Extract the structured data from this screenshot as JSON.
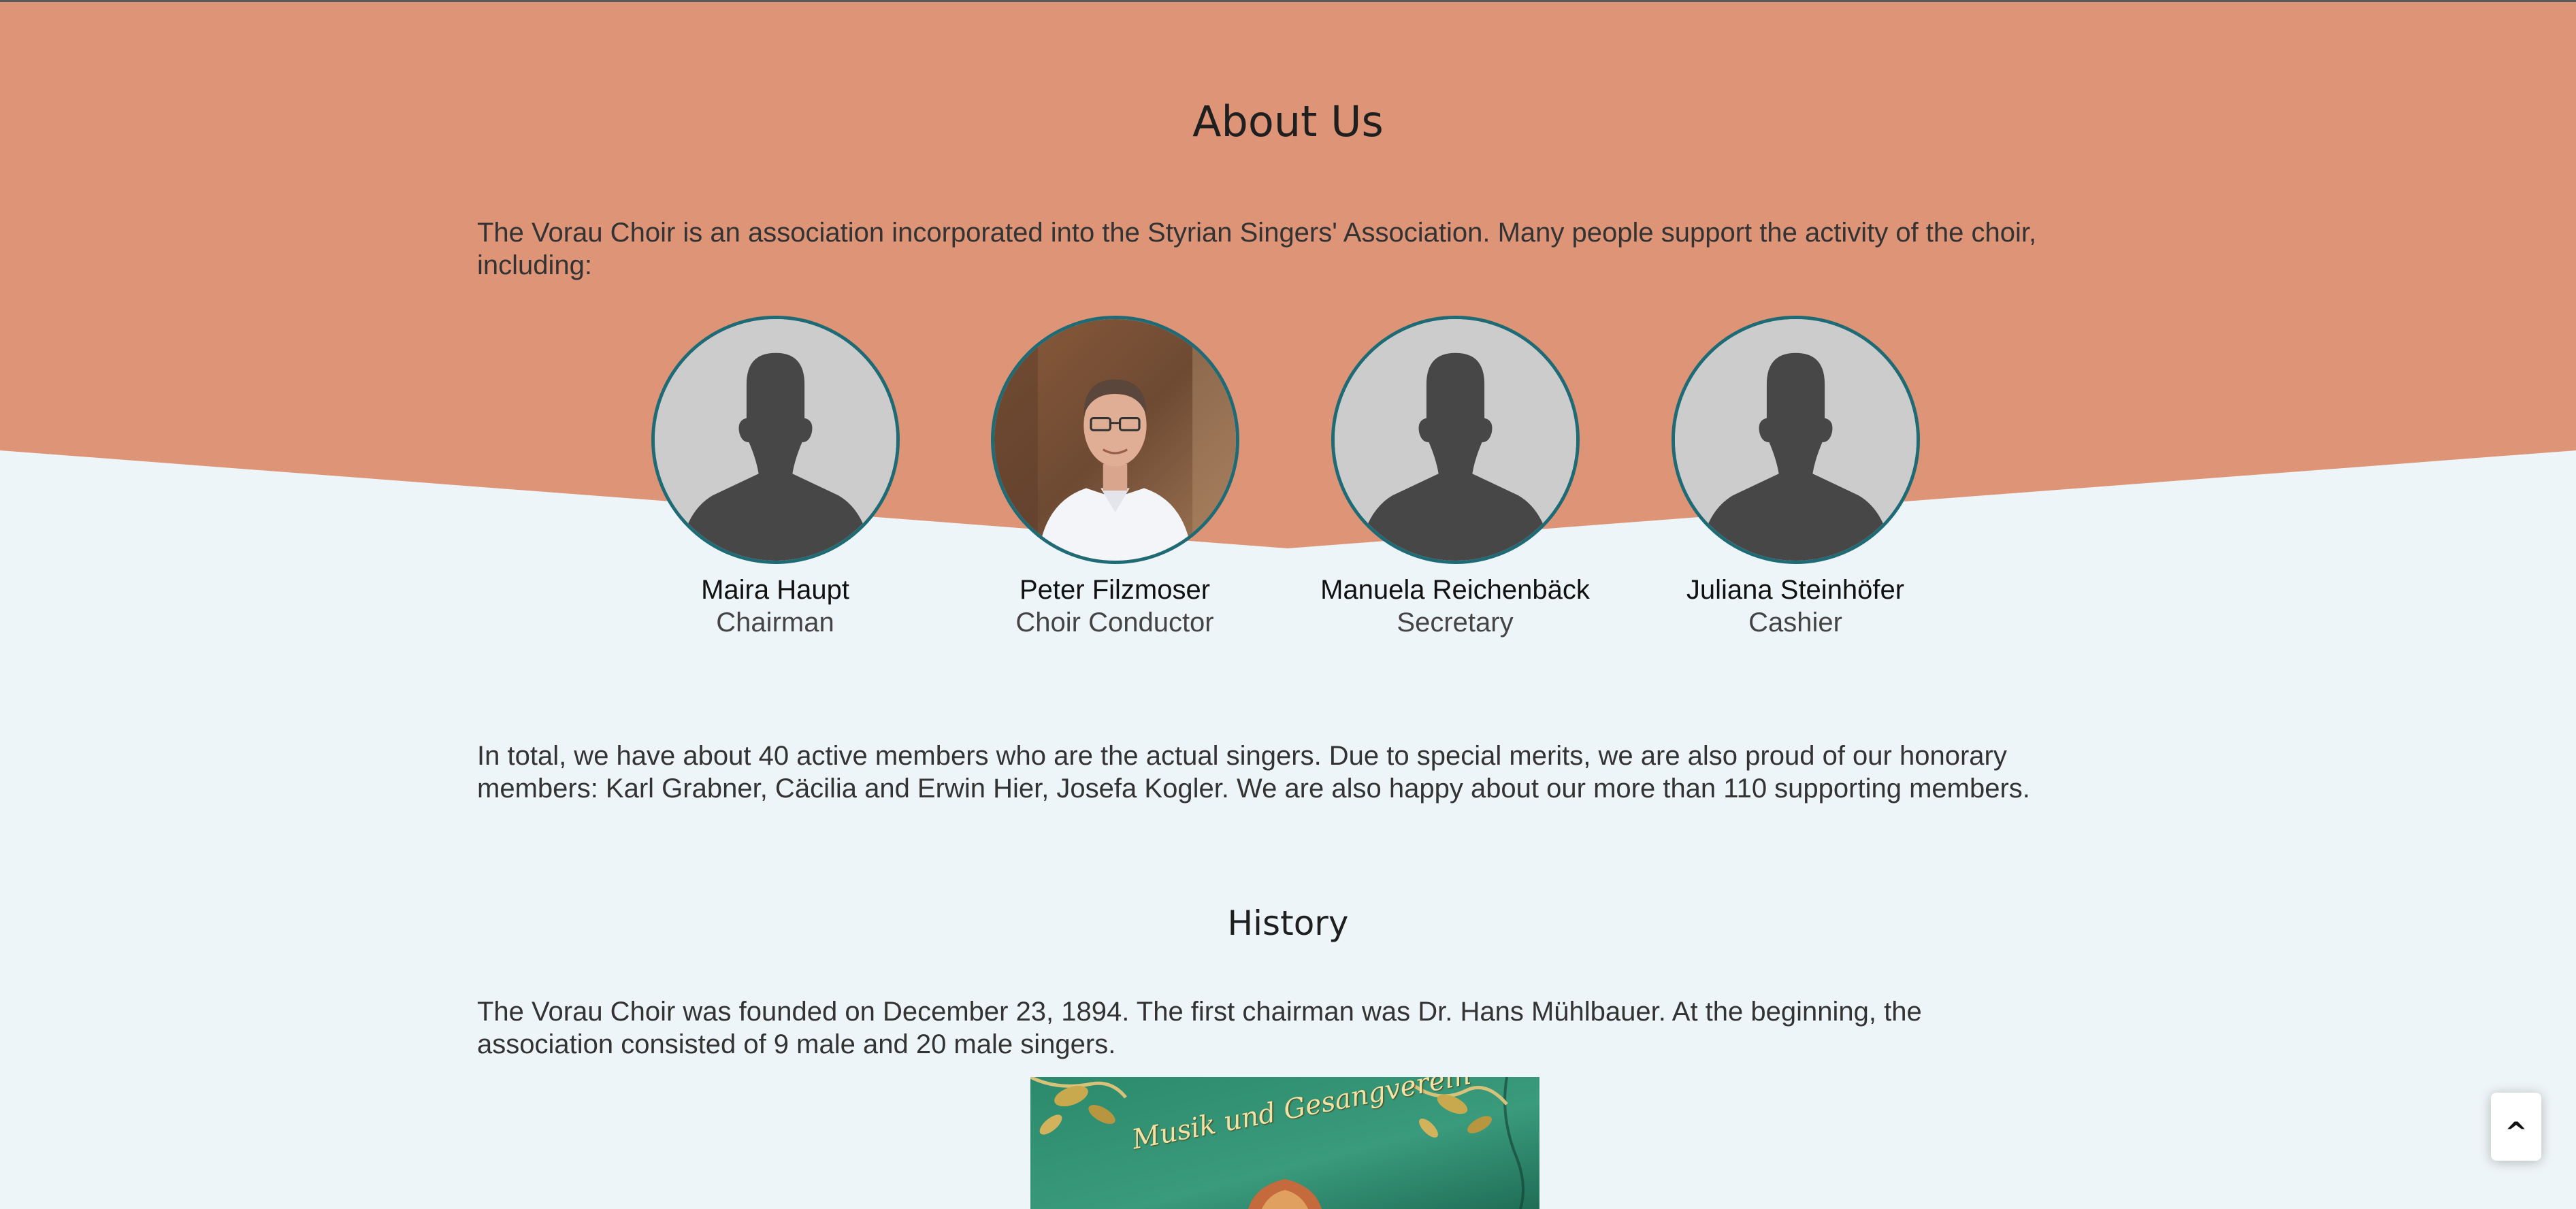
{
  "about": {
    "title": "About Us",
    "intro": "The Vorau Choir is an association incorporated into the Styrian Singers' Association. Many people support the activity of the choir, including:"
  },
  "people": [
    {
      "name": "Maira Haupt",
      "role": "Chairman",
      "photo": "placeholder-silhouette"
    },
    {
      "name": "Peter Filzmoser",
      "role": "Choir Conductor",
      "photo": "portrait-photo"
    },
    {
      "name": "Manuela Reichenbäck",
      "role": "Secretary",
      "photo": "placeholder-silhouette"
    },
    {
      "name": "Juliana Steinhöfer",
      "role": "Cashier",
      "photo": "placeholder-silhouette"
    }
  ],
  "members_text": "In total, we have about 40 active members who are the actual singers. Due to special merits, we are also proud of our honorary members: Karl Grabner, Cäcilia and Erwin Hier, Josefa Kogler. We are also happy about our more than 110 supporting members.",
  "history": {
    "title": "History",
    "text": "The Vorau Choir was founded on December 23, 1894. The first chairman was Dr. Hans Mühlbauer. At the beginning, the association consisted of 9 male and 20 male singers.",
    "banner_text": "Musik und Gesangverein"
  },
  "scroll_top_label": "^",
  "colors": {
    "hero": "#dd9477",
    "background": "#eef5f8",
    "avatar_border": "#1f6b75",
    "silhouette": "#474747",
    "avatar_bg": "#cccccc"
  }
}
